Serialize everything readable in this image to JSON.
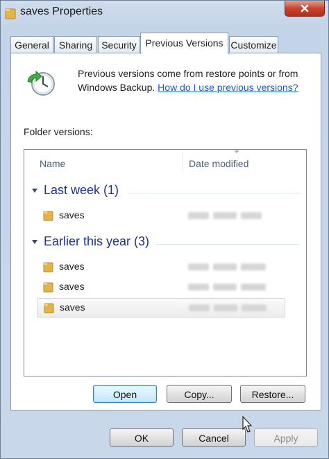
{
  "window": {
    "title": "saves Properties",
    "icons": {
      "title": "folder-icon",
      "close": "close-icon"
    }
  },
  "tabs": [
    {
      "label": "General"
    },
    {
      "label": "Sharing"
    },
    {
      "label": "Security"
    },
    {
      "label": "Previous Versions",
      "active": true
    },
    {
      "label": "Customize"
    }
  ],
  "panel": {
    "intro_text": "Previous versions come from restore points or from Windows Backup.",
    "help_link": "How do I use previous versions?",
    "versions_label": "Folder versions:",
    "columns": {
      "name": "Name",
      "date": "Date modified"
    },
    "groups": [
      {
        "title": "Last week (1)",
        "items": [
          {
            "name": "saves",
            "date_redacted": true
          }
        ]
      },
      {
        "title": "Earlier this year (3)",
        "items": [
          {
            "name": "saves",
            "date_redacted": true
          },
          {
            "name": "saves",
            "date_redacted": true
          },
          {
            "name": "saves",
            "date_redacted": true,
            "selected": true
          }
        ]
      }
    ]
  },
  "panel_buttons": {
    "open": "Open",
    "copy": "Copy...",
    "restore": "Restore..."
  },
  "dialog_buttons": {
    "ok": "OK",
    "cancel": "Cancel",
    "apply": "Apply"
  },
  "colors": {
    "link": "#1a5bbf",
    "group_title": "#1e3287",
    "close_button": "#c7442f"
  }
}
